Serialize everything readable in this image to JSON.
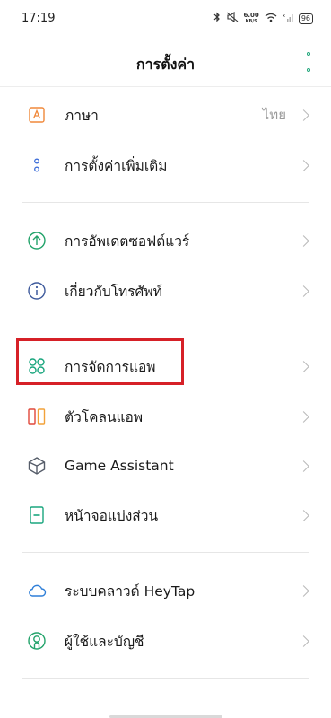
{
  "status": {
    "time": "17:19",
    "net_speed_value": "6.00",
    "net_speed_unit": "KB/S",
    "battery": "96"
  },
  "header": {
    "title": "การตั้งค่า"
  },
  "items": [
    {
      "label": "ภาษา",
      "value": "ไทย",
      "icon": "language-icon"
    },
    {
      "label": "การตั้งค่าเพิ่มเติม",
      "icon": "more-settings-icon"
    },
    {
      "label": "การอัพเดตซอฟต์แวร์",
      "icon": "software-update-icon"
    },
    {
      "label": "เกี่ยวกับโทรศัพท์",
      "icon": "about-phone-icon"
    },
    {
      "label": "การจัดการแอพ",
      "icon": "app-management-icon"
    },
    {
      "label": "ตัวโคลนแอพ",
      "icon": "app-clone-icon"
    },
    {
      "label": "Game Assistant",
      "icon": "game-assistant-icon"
    },
    {
      "label": "หน้าจอแบ่งส่วน",
      "icon": "split-screen-icon"
    },
    {
      "label": "ระบบคลาวด์ HeyTap",
      "icon": "cloud-icon"
    },
    {
      "label": "ผู้ใช้และบัญชี",
      "icon": "users-accounts-icon"
    }
  ],
  "colors": {
    "accent": "#1fa67a",
    "highlight": "#d62027"
  }
}
